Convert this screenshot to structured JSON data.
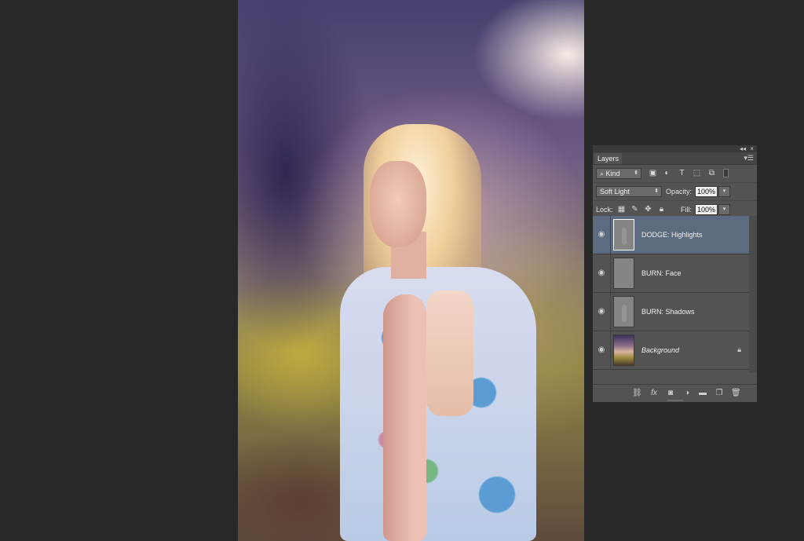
{
  "panel": {
    "collapse_glyph": "◂◂",
    "close_glyph": "×",
    "tab_label": "Layers",
    "menu_glyph": "▾☰",
    "filter": {
      "kind_label": "Kind",
      "icons": [
        "image-filter-icon",
        "adjustment-filter-icon",
        "type-filter-icon",
        "shape-filter-icon",
        "smart-object-filter-icon"
      ]
    },
    "blend_mode": "Soft Light",
    "opacity_label": "Opacity:",
    "opacity_value": "100%",
    "lock_label": "Lock:",
    "fill_label": "Fill:",
    "fill_value": "100%",
    "layers": [
      {
        "name": "DODGE: Highlights",
        "visible": true,
        "selected": true
      },
      {
        "name": "BURN: Face",
        "visible": true,
        "selected": false
      },
      {
        "name": "BURN:  Shadows",
        "visible": true,
        "selected": false
      },
      {
        "name": "Background",
        "visible": true,
        "selected": false,
        "locked": true
      }
    ],
    "bottom_icons": [
      "link-layers-icon",
      "fx-icon",
      "layer-mask-icon",
      "adjustment-layer-icon",
      "new-group-icon",
      "new-layer-icon",
      "trash-icon"
    ],
    "fx_label": "fx"
  },
  "accent_colors": {
    "selected_layer": "#5d6b80",
    "panel_bg": "#535353",
    "workspace_bg": "#282828"
  }
}
